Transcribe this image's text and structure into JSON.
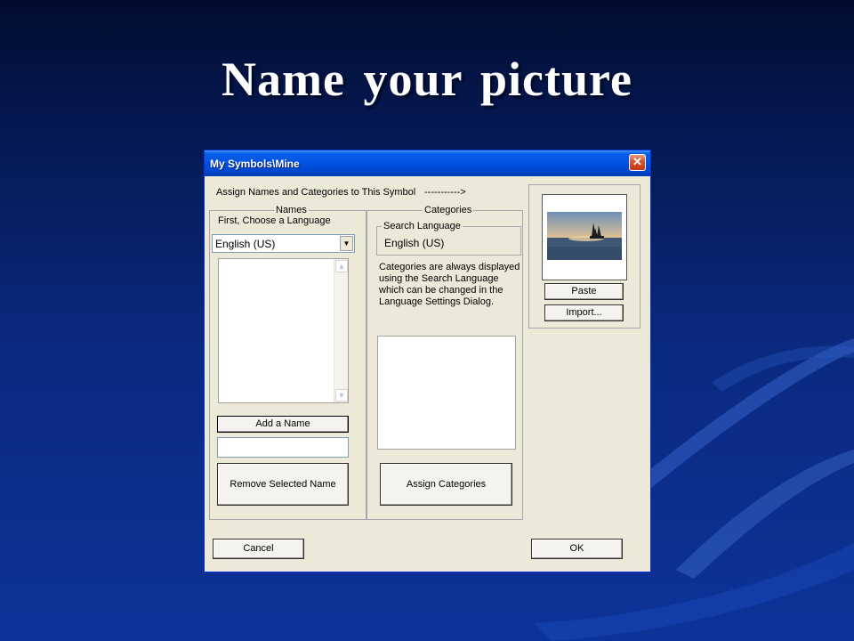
{
  "slide": {
    "title": "Name  your  picture"
  },
  "dialog": {
    "title": "My Symbols\\Mine",
    "close_glyph": "✕",
    "assign_text": "Assign Names and Categories to This Symbol",
    "arrow_text": "----------->",
    "names": {
      "group_label": "Names",
      "choose_language_label": "First, Choose a Language",
      "language_value": "English (US)",
      "add_name_label": "Add a Name",
      "name_input_value": "",
      "remove_label": "Remove Selected Name"
    },
    "categories": {
      "group_label": "Categories",
      "search_language_label": "Search Language",
      "search_language_value": "English (US)",
      "info_line1": "Categories are always displayed",
      "info_line2": "using the Search Language",
      "info_line3": "which can be changed in the",
      "info_line4": "Language Settings Dialog.",
      "assign_label": "Assign Categories"
    },
    "picture": {
      "paste_label": "Paste",
      "import_label": "Import..."
    },
    "cancel_label": "Cancel",
    "ok_label": "OK"
  },
  "icons": {
    "dropdown": "chevron-down-icon",
    "scroll_up": "scroll-up-icon",
    "scroll_down": "scroll-down-icon",
    "close": "close-icon"
  },
  "colors": {
    "titlebar": "#0054e3",
    "close_button": "#d8532f",
    "dialog_face": "#ece9d8",
    "slide_background": "#0a2a80"
  }
}
